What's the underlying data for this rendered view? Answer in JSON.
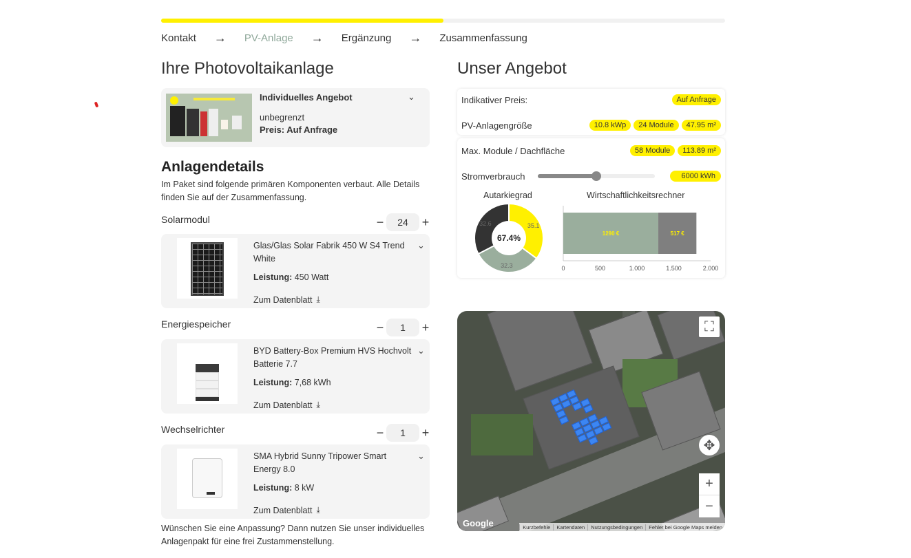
{
  "progress": {
    "fraction": 0.5
  },
  "steps": [
    "Kontakt",
    "PV-Anlage",
    "Ergänzung",
    "Zusammenfassung"
  ],
  "left": {
    "title": "Ihre Photovoltaikanlage",
    "offer": {
      "title": "Individuelles Angebot",
      "subtitle": "unbegrenzt",
      "price": "Preis: Auf Anfrage"
    },
    "details_title": "Anlagendetails",
    "details_desc": "Im Paket sind folgende primären Komponenten verbaut. Alle Details finden Sie auf der Zusammenfassung.",
    "components": [
      {
        "label": "Solarmodul",
        "qty": "24",
        "name": "Glas/Glas Solar Fabrik 450 W S4 Trend White",
        "power_label": "Leistung:",
        "power": "450 Watt",
        "link": "Zum Datenblatt"
      },
      {
        "label": "Energiespeicher",
        "qty": "1",
        "name": "BYD Battery-Box Premium HVS Hochvolt Batterie 7.7",
        "power_label": "Leistung:",
        "power": "7,68 kWh",
        "link": "Zum Datenblatt"
      },
      {
        "label": "Wechselrichter",
        "qty": "1",
        "name": "SMA Hybrid Sunny Tripower Smart Energy 8.0",
        "power_label": "Leistung:",
        "power": "8 kW",
        "link": "Zum Datenblatt"
      }
    ],
    "bottom_note": "Wünschen Sie eine Anpassung? Dann nutzen Sie unser individuelles Anlagenpakt für eine frei Zustammenstellung."
  },
  "right": {
    "title": "Unser Angebot",
    "rows": {
      "price_label": "Indikativer Preis:",
      "price_value": "Auf Anfrage",
      "size_label": "PV-Anlagengröße",
      "size_values": [
        "10.8 kWp",
        "24 Module",
        "47.95 m²"
      ],
      "max_label": "Max. Module / Dachfläche",
      "max_values": [
        "58 Module",
        "113.89 m²"
      ],
      "consumption_label": "Stromverbrauch",
      "consumption_value": "6000 kWh",
      "consumption_slider_fraction": 0.5
    },
    "autarky_title": "Autarkiegrad",
    "economy_title": "Wirtschaftlichkeitsrechner"
  },
  "chart_data": [
    {
      "type": "pie",
      "title": "Autarkiegrad",
      "center_label": "67.4%",
      "slices": [
        {
          "value": 35.1,
          "label": "35.1",
          "color": "#fff000"
        },
        {
          "value": 32.3,
          "label": "32.3",
          "color": "#9aae9d"
        },
        {
          "value": 32.6,
          "label": "32.6",
          "color": "#333333"
        }
      ]
    },
    {
      "type": "bar",
      "title": "Wirtschaftlichkeitsrechner",
      "orientation": "horizontal",
      "stacked": true,
      "series": [
        {
          "value": 1290,
          "label": "1290 €",
          "color": "#9aae9d"
        },
        {
          "value": 517,
          "label": "517 €",
          "color": "#7f7f7f"
        }
      ],
      "xlim": [
        0,
        2000
      ],
      "xticks": [
        "0",
        "500",
        "1.000",
        "1.500",
        "2.000"
      ]
    }
  ],
  "map": {
    "logo": "Google",
    "attribution": [
      "Kurzbefehle",
      "Kartendaten",
      "Nutzungsbedingungen",
      "Fehler bei Google Maps melden"
    ]
  },
  "colors": {
    "accent": "#fff000",
    "active_step": "#8fa89a",
    "panel_blue": "#3c86f3"
  }
}
